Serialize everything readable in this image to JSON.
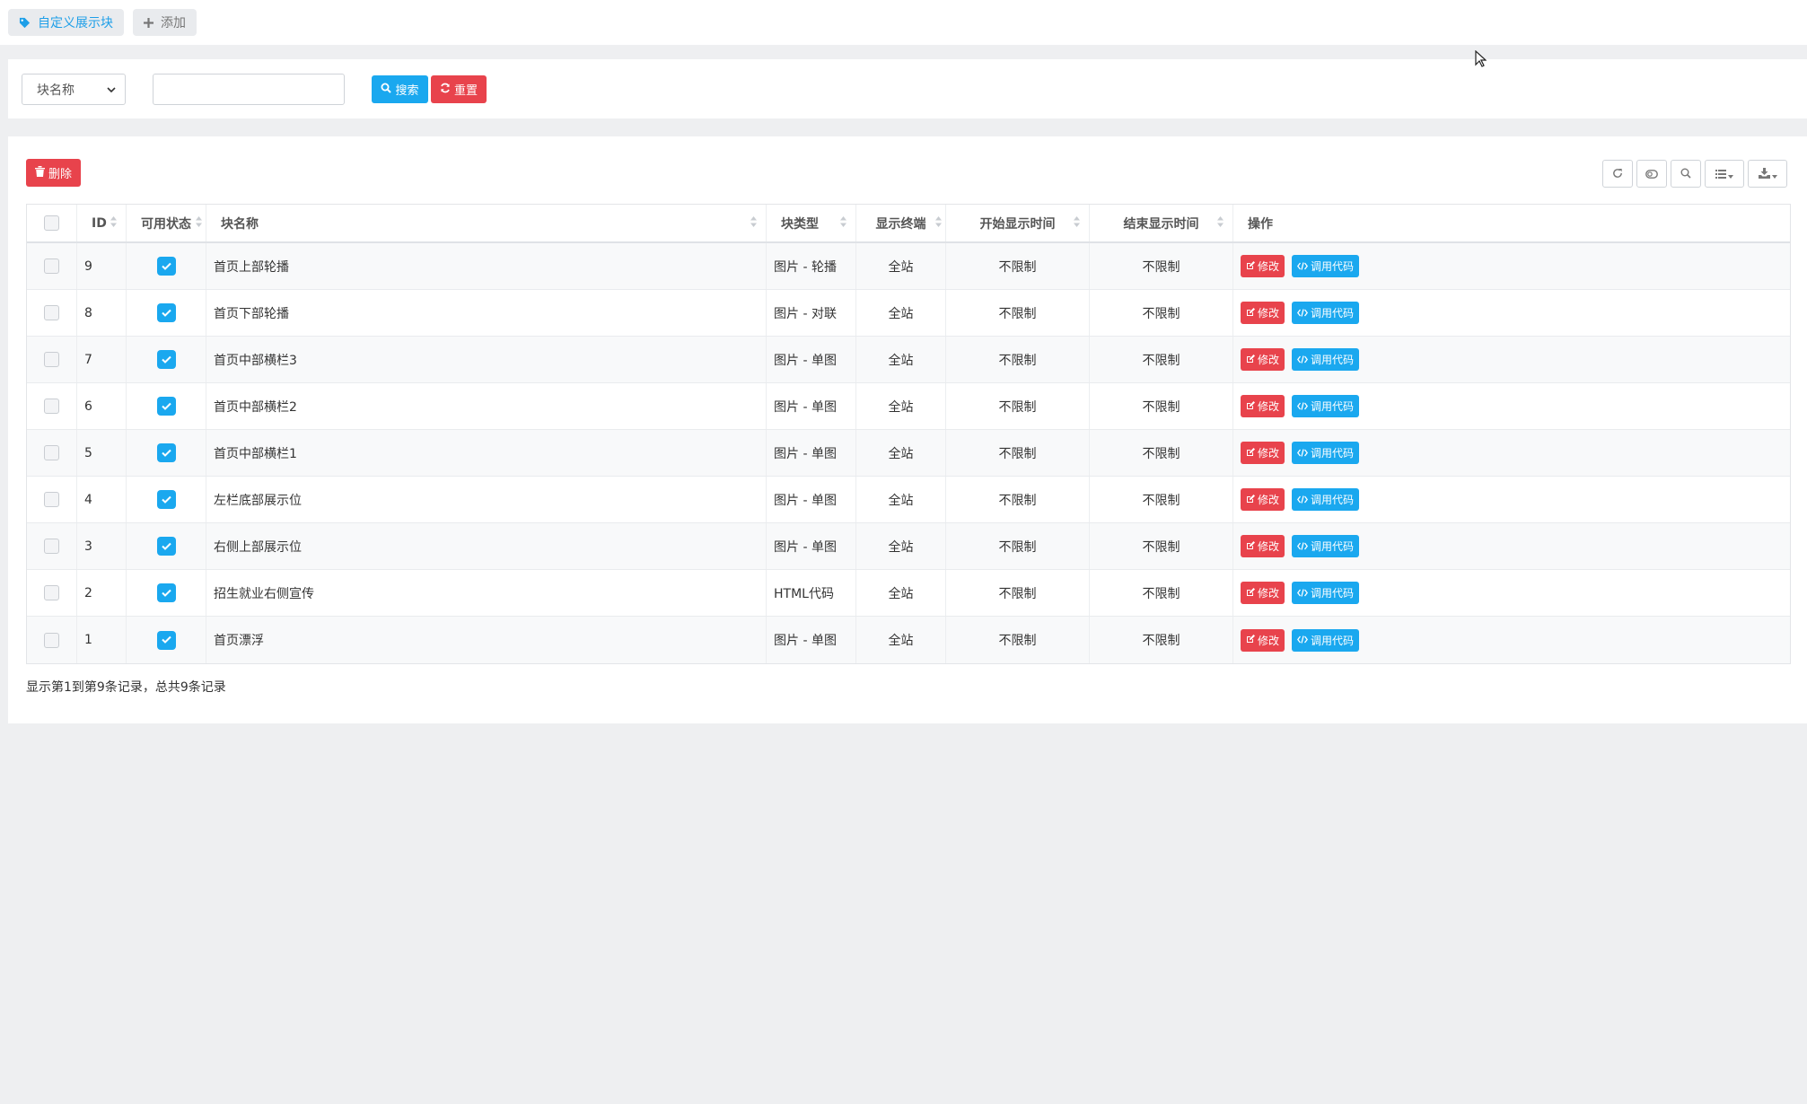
{
  "tabs": {
    "active_label": "自定义展示块",
    "add_label": "添加"
  },
  "search": {
    "field_select": "块名称",
    "keyword_value": "",
    "search_label": "搜索",
    "reset_label": "重置"
  },
  "toolbar": {
    "delete_label": "删除",
    "icons": [
      "refresh-icon",
      "toggle-icon",
      "search-icon",
      "columns-icon",
      "export-icon"
    ]
  },
  "table": {
    "headers": {
      "id": "ID",
      "status": "可用状态",
      "name": "块名称",
      "type": "块类型",
      "terminal": "显示终端",
      "start": "开始显示时间",
      "end": "结束显示时间",
      "actions": "操作"
    },
    "edit_label": "修改",
    "code_label": "调用代码",
    "rows": [
      {
        "id": "9",
        "enabled": true,
        "name": "首页上部轮播",
        "type": "图片 - 轮播",
        "terminal": "全站",
        "start": "不限制",
        "end": "不限制"
      },
      {
        "id": "8",
        "enabled": true,
        "name": "首页下部轮播",
        "type": "图片 - 对联",
        "terminal": "全站",
        "start": "不限制",
        "end": "不限制"
      },
      {
        "id": "7",
        "enabled": true,
        "name": "首页中部横栏3",
        "type": "图片 - 单图",
        "terminal": "全站",
        "start": "不限制",
        "end": "不限制"
      },
      {
        "id": "6",
        "enabled": true,
        "name": "首页中部横栏2",
        "type": "图片 - 单图",
        "terminal": "全站",
        "start": "不限制",
        "end": "不限制"
      },
      {
        "id": "5",
        "enabled": true,
        "name": "首页中部横栏1",
        "type": "图片 - 单图",
        "terminal": "全站",
        "start": "不限制",
        "end": "不限制"
      },
      {
        "id": "4",
        "enabled": true,
        "name": "左栏底部展示位",
        "type": "图片 - 单图",
        "terminal": "全站",
        "start": "不限制",
        "end": "不限制"
      },
      {
        "id": "3",
        "enabled": true,
        "name": "右侧上部展示位",
        "type": "图片 - 单图",
        "terminal": "全站",
        "start": "不限制",
        "end": "不限制"
      },
      {
        "id": "2",
        "enabled": true,
        "name": "招生就业右侧宣传",
        "type": "HTML代码",
        "terminal": "全站",
        "start": "不限制",
        "end": "不限制"
      },
      {
        "id": "1",
        "enabled": true,
        "name": "首页漂浮",
        "type": "图片 - 单图",
        "terminal": "全站",
        "start": "不限制",
        "end": "不限制"
      }
    ]
  },
  "footer": {
    "summary": "显示第1到第9条记录，总共9条记录"
  }
}
